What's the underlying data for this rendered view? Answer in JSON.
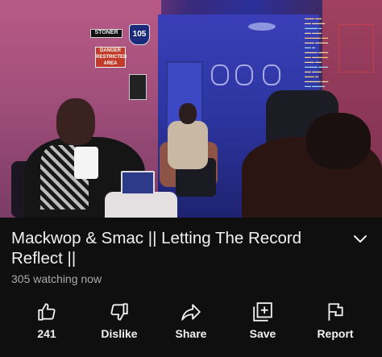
{
  "video": {
    "title": "Mackwop & Smac || Letting The Record Reflect ||",
    "viewers": "305 watching now",
    "scene_signs": {
      "stoner": "STONER",
      "route": "105",
      "danger": "DANGER RESTRICTED AREA"
    }
  },
  "actions": [
    {
      "id": "like",
      "label": "241",
      "icon": "thumbs-up-icon"
    },
    {
      "id": "dislike",
      "label": "Dislike",
      "icon": "thumbs-down-icon"
    },
    {
      "id": "share",
      "label": "Share",
      "icon": "share-arrow-icon"
    },
    {
      "id": "save",
      "label": "Save",
      "icon": "add-to-playlist-icon"
    },
    {
      "id": "report",
      "label": "Report",
      "icon": "flag-icon"
    }
  ],
  "colors": {
    "background": "#0f0f0f",
    "text_primary": "#f1f1f1",
    "text_secondary": "#aaaaaa"
  }
}
